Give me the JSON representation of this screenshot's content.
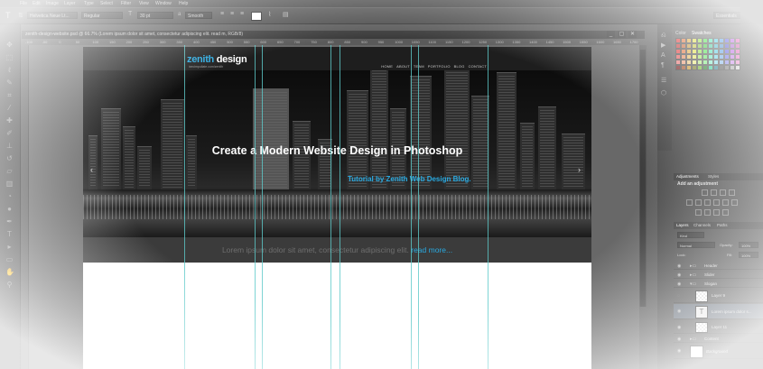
{
  "menu": [
    "File",
    "Edit",
    "Image",
    "Layer",
    "Type",
    "Select",
    "Filter",
    "View",
    "Window",
    "Help"
  ],
  "options_bar": {
    "font_family": "Helvetica Neue Lt...",
    "font_style": "Regular",
    "font_size": "30 pt",
    "aa_label": "a",
    "aa_mode": "Smooth"
  },
  "workspace_label": "Essentials",
  "document": {
    "title": "zenith-design-website.psd @ 66.7% (Lorem ipsum dolor sit amet, consectetur adipiscing elit. read m, RGB/8)",
    "window_buttons": [
      "_",
      "▢",
      "✕"
    ],
    "ruler_ticks": [
      "-100",
      "-50",
      "0",
      "50",
      "100",
      "150",
      "200",
      "250",
      "300",
      "350",
      "400",
      "450",
      "500",
      "550",
      "600",
      "650",
      "700",
      "750",
      "800",
      "850",
      "900",
      "950",
      "1000",
      "1050",
      "1100",
      "1150",
      "1200",
      "1250",
      "1300",
      "1350",
      "1400",
      "1450",
      "1500",
      "1550",
      "1600",
      "1650",
      "1700"
    ]
  },
  "site": {
    "logo_prefix": "zenith",
    "logo_suffix": " design",
    "logo_sub": "ixecimpuliate.com/zenith",
    "nav": [
      "HOME",
      "ABOUT",
      "TEAM",
      "PORTFOLIO",
      "BLOG",
      "CONTACT"
    ],
    "hero_title": "Create a Modern Website Design in Photoshop",
    "hero_sub": "Tutorial by Zenith Web Design Blog.",
    "slogan": "Lorem ipsum dolor sit amet, consectetur adipiscing elit. ",
    "slogan_link": "read more...",
    "arrow_left": "‹",
    "arrow_right": "›"
  },
  "panels": {
    "swatch_tabs": [
      "Color",
      "Swatches"
    ],
    "adjust_tabs": [
      "Adjustments",
      "Styles"
    ],
    "adjust_title": "Add an adjustment",
    "layer_tabs": [
      "Layers",
      "Channels",
      "Paths"
    ],
    "filter_kind": "Kind",
    "blend_mode": "Normal",
    "opacity_label": "Opacity:",
    "opacity_value": "100%",
    "lock_label": "Lock:",
    "fill_label": "Fill:",
    "fill_value": "100%",
    "layers": [
      {
        "name": "Header",
        "type": "group"
      },
      {
        "name": "Slider",
        "type": "group"
      },
      {
        "name": "Slogan",
        "type": "group"
      },
      {
        "name": "Layer 9",
        "type": "pixel"
      },
      {
        "name": "Lorem ipsum dolor s...",
        "type": "text"
      },
      {
        "name": "Layer 11",
        "type": "pixel"
      },
      {
        "name": "Content",
        "type": "group"
      },
      {
        "name": "Background",
        "type": "pixel"
      }
    ]
  },
  "colors": {
    "accent": "#29a9e0",
    "guide": "#5ec9c9",
    "header": "#1e1e1e"
  }
}
